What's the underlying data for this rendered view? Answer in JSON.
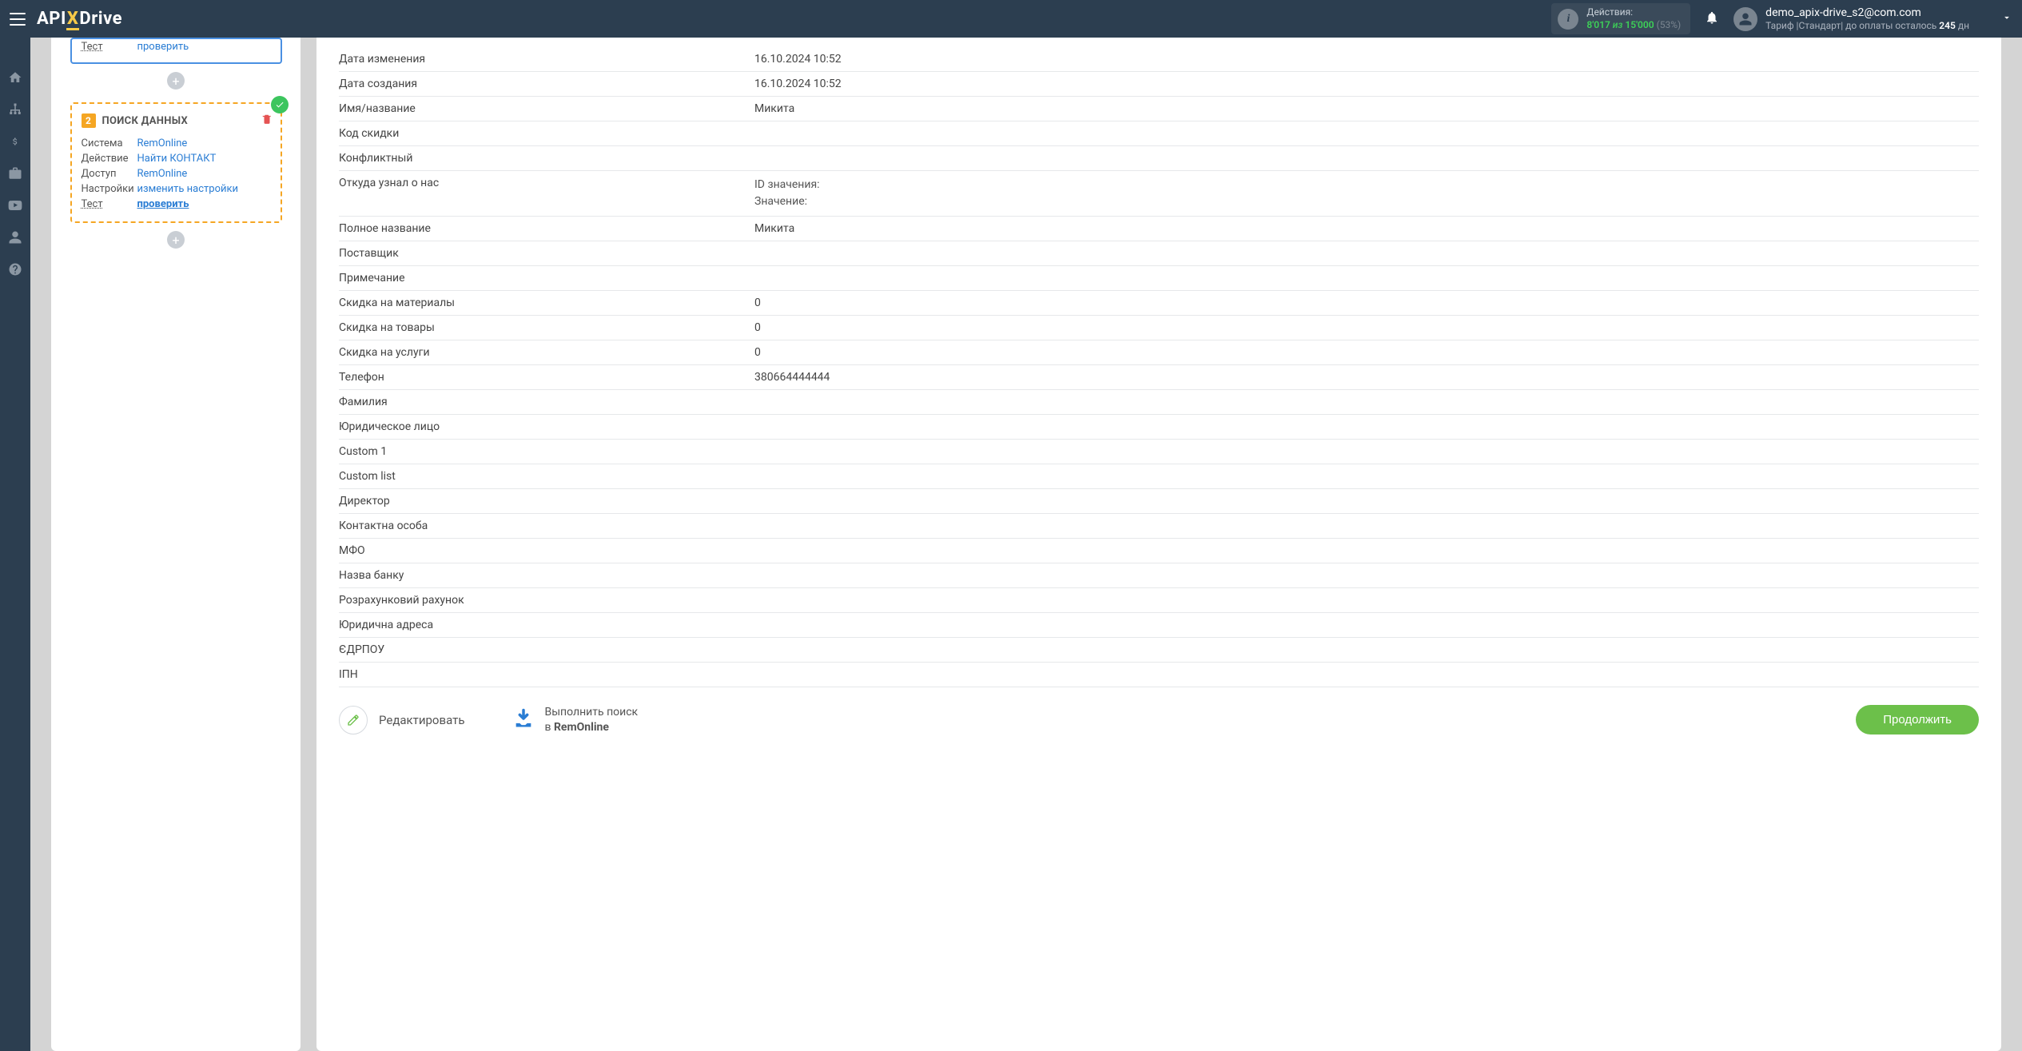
{
  "header": {
    "logo_pre": "API",
    "logo_x": "X",
    "logo_post": "Drive",
    "actions_label": "Действия:",
    "actions_used": "8'017",
    "actions_iz": "из",
    "actions_total": "15'000",
    "actions_pct": "(53%)",
    "user_email": "demo_apix-drive_s2@com.com",
    "tariff_pre": "Тариф |Стандарт| до оплаты осталось ",
    "tariff_days": "245",
    "tariff_suf": " дн"
  },
  "left": {
    "card1_test_label": "Тест",
    "card1_test_val": "проверить",
    "card2_num": "2",
    "card2_title": "ПОИСК ДАННЫХ",
    "rows": {
      "system_l": "Система",
      "system_v": "RemOnline",
      "action_l": "Действие",
      "action_v": "Найти КОНТАКТ",
      "access_l": "Доступ",
      "access_v": "RemOnline",
      "settings_l": "Настройки",
      "settings_v": "изменить настройки",
      "test_l": "Тест",
      "test_v": "проверить"
    }
  },
  "details": [
    {
      "k": "Дата изменения",
      "v": "16.10.2024 10:52"
    },
    {
      "k": "Дата создания",
      "v": "16.10.2024 10:52"
    },
    {
      "k": "Имя/название",
      "v": "Микита"
    },
    {
      "k": "Код скидки",
      "v": ""
    },
    {
      "k": "Конфликтный",
      "v": ""
    },
    {
      "k": "Откуда узнал о нас",
      "v_lines": [
        "ID значения:",
        "Значение:"
      ]
    },
    {
      "k": "Полное название",
      "v": "Микита"
    },
    {
      "k": "Поставщик",
      "v": ""
    },
    {
      "k": "Примечание",
      "v": ""
    },
    {
      "k": "Скидка на материалы",
      "v": "0"
    },
    {
      "k": "Скидка на товары",
      "v": "0"
    },
    {
      "k": "Скидка на услуги",
      "v": "0"
    },
    {
      "k": "Телефон",
      "v": "380664444444"
    },
    {
      "k": "Фамилия",
      "v": ""
    },
    {
      "k": "Юридическое лицо",
      "v": ""
    },
    {
      "k": "Custom 1",
      "v": ""
    },
    {
      "k": "Custom list",
      "v": ""
    },
    {
      "k": "Директор",
      "v": ""
    },
    {
      "k": "Контактна особа",
      "v": ""
    },
    {
      "k": "МФО",
      "v": ""
    },
    {
      "k": "Назва банку",
      "v": ""
    },
    {
      "k": "Розрахунковий рахунок",
      "v": ""
    },
    {
      "k": "Юридична адреса",
      "v": ""
    },
    {
      "k": "ЄДРПОУ",
      "v": ""
    },
    {
      "k": "ІПН",
      "v": ""
    }
  ],
  "footer": {
    "edit": "Редактировать",
    "search_l1": "Выполнить поиск",
    "search_l2_pre": "в ",
    "search_l2_sys": "RemOnline",
    "continue": "Продолжить"
  }
}
